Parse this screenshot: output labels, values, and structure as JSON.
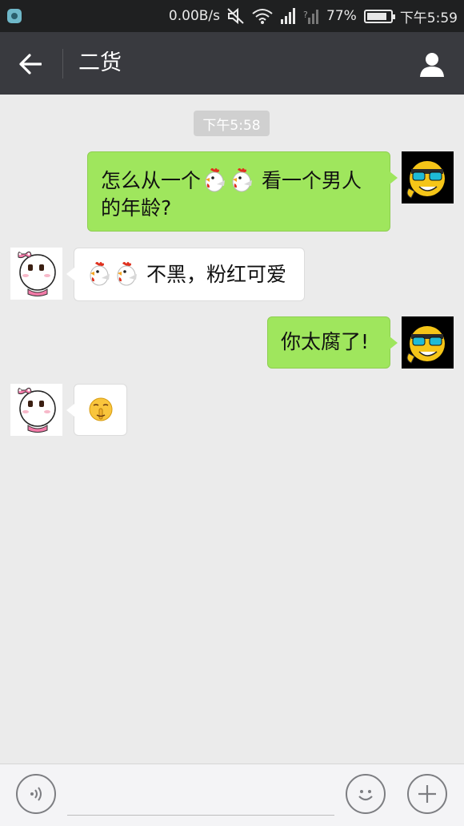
{
  "status_bar": {
    "speed": "0.00B/s",
    "battery": "77%",
    "time": "下午5:59"
  },
  "header": {
    "title": "二货"
  },
  "chat": {
    "timestamp": "下午5:58",
    "messages": [
      {
        "direction": "out",
        "text_a": "怎么从一个",
        "text_b": "看一个男人",
        "text_c": "的年龄?"
      },
      {
        "direction": "in",
        "text": "不黑，粉红可爱"
      },
      {
        "direction": "out",
        "text": "你太腐了!"
      },
      {
        "direction": "in",
        "emoji": "shush-emoji"
      }
    ]
  },
  "colors": {
    "outgoing_bubble": "#9fe65d",
    "incoming_bubble": "#ffffff",
    "header_bg": "#393a3f",
    "chat_bg": "#ebebeb"
  }
}
